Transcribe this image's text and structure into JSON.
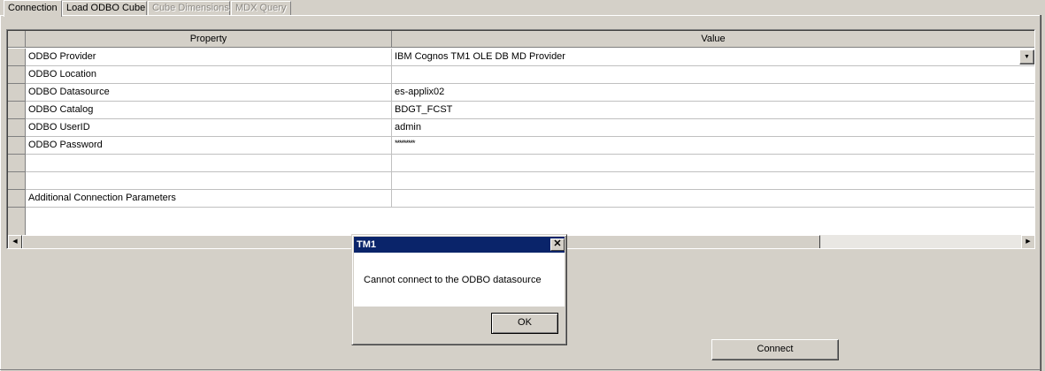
{
  "tabs": [
    {
      "label": "Connection",
      "state": "active"
    },
    {
      "label": "Load ODBO Cube",
      "state": "enabled"
    },
    {
      "label": "Cube Dimensions",
      "state": "disabled"
    },
    {
      "label": "MDX Query",
      "state": "disabled"
    }
  ],
  "grid": {
    "columns": {
      "property": "Property",
      "value": "Value"
    },
    "rows": [
      {
        "property": "ODBO Provider",
        "value": "IBM Cognos TM1 OLE DB MD Provider",
        "control": "dropdown"
      },
      {
        "property": "ODBO Location",
        "value": ""
      },
      {
        "property": "ODBO Datasource",
        "value": "es-applix02"
      },
      {
        "property": "ODBO Catalog",
        "value": "BDGT_FCST"
      },
      {
        "property": "ODBO UserID",
        "value": "admin"
      },
      {
        "property": "ODBO Password",
        "value": "*********"
      },
      {
        "property": "",
        "value": ""
      },
      {
        "property": "",
        "value": ""
      },
      {
        "property": "Additional Connection Parameters",
        "value": ""
      }
    ]
  },
  "icons": {
    "dropdown": "chevron-down-icon",
    "scroll_left": "arrow-left-icon",
    "scroll_right": "arrow-right-icon",
    "close": "close-icon"
  },
  "buttons": {
    "connect": "Connect"
  },
  "dialog": {
    "title": "TM1",
    "close_glyph": "✕",
    "message": "Cannot connect to the ODBO datasource",
    "ok_label": "OK"
  },
  "colors": {
    "titlebar": "#0a246a",
    "face": "#d4d0c8"
  }
}
